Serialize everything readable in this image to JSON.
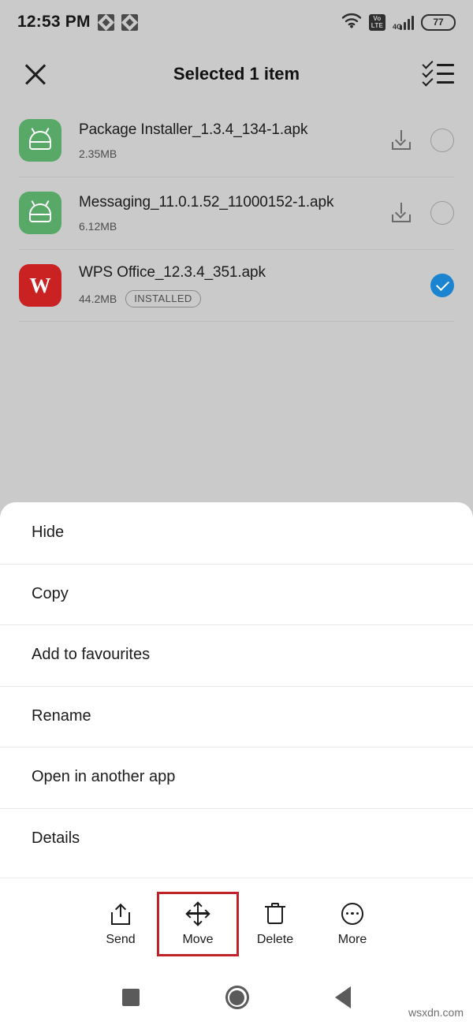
{
  "status_bar": {
    "time": "12:53 PM",
    "notification_icons": [
      "app-notification-icon",
      "app-notification-icon"
    ],
    "wifi_icon": "wifi-icon",
    "volte_top": "Vo",
    "volte_bottom": "LTE",
    "network_type": "4G",
    "signal_icon": "signal-bars-icon",
    "battery_level": "77"
  },
  "app_bar": {
    "close_icon": "close-icon",
    "title": "Selected 1 item",
    "select_all_icon": "select-all-icon"
  },
  "files": [
    {
      "name": "Package Installer_1.3.4_134-1.apk",
      "size": "2.35MB",
      "badge": "",
      "icon_type": "android-apk-icon",
      "icon_color": "#58a968",
      "download_icon": "download-icon",
      "selected": false
    },
    {
      "name": "Messaging_11.0.1.52_11000152-1.apk",
      "size": "6.12MB",
      "badge": "",
      "icon_type": "android-apk-icon",
      "icon_color": "#58a968",
      "download_icon": "download-icon",
      "selected": false
    },
    {
      "name": "WPS Office_12.3.4_351.apk",
      "size": "44.2MB",
      "badge": "INSTALLED",
      "icon_type": "wps-office-icon",
      "icon_color": "#ca2222",
      "icon_letter": "W",
      "download_icon": "",
      "selected": true
    }
  ],
  "sheet_menu": {
    "items": [
      {
        "label": "Hide"
      },
      {
        "label": "Copy"
      },
      {
        "label": "Add to favourites"
      },
      {
        "label": "Rename"
      },
      {
        "label": "Open in another app"
      },
      {
        "label": "Details"
      }
    ]
  },
  "action_bar": {
    "actions": [
      {
        "label": "Send",
        "icon": "share-icon",
        "highlighted": false
      },
      {
        "label": "Move",
        "icon": "move-icon",
        "highlighted": true
      },
      {
        "label": "Delete",
        "icon": "trash-icon",
        "highlighted": false
      },
      {
        "label": "More",
        "icon": "more-icon",
        "highlighted": false
      }
    ],
    "highlight_color": "#c0222a"
  },
  "nav_bar": {
    "recents_icon": "recents-square-icon",
    "home_icon": "home-circle-icon",
    "back_icon": "back-triangle-icon"
  },
  "watermark": "wsxdn.com",
  "colors": {
    "screen_background": "#cacaca",
    "sheet_background": "#ffffff",
    "selection_blue": "#1a84d0",
    "apk_green": "#58a968",
    "wps_red": "#ca2222"
  }
}
